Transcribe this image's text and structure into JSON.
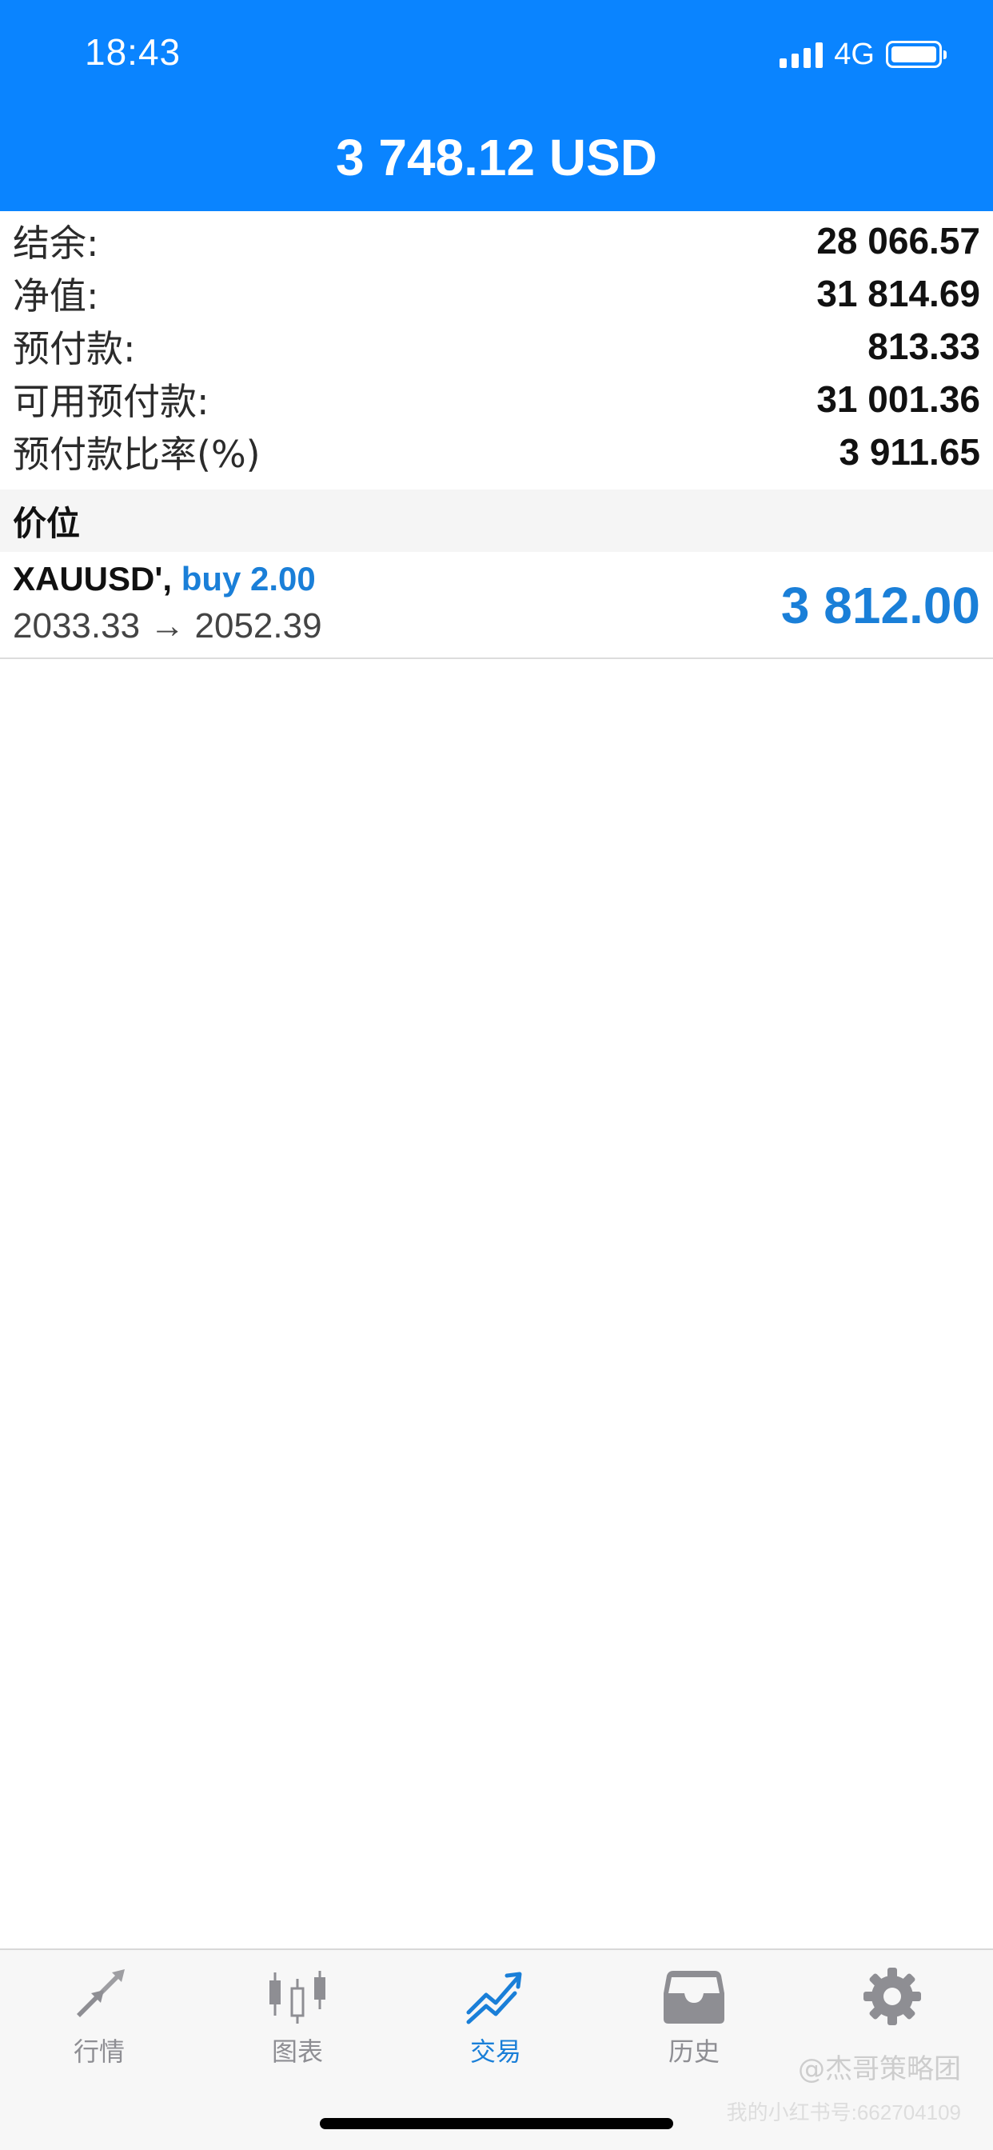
{
  "status_bar": {
    "time": "18:43",
    "network": "4G"
  },
  "header": {
    "title": "3 748.12 USD"
  },
  "summary": [
    {
      "label": "结余:",
      "value": "28 066.57"
    },
    {
      "label": "净值:",
      "value": "31 814.69"
    },
    {
      "label": "预付款:",
      "value": "813.33"
    },
    {
      "label": "可用预付款:",
      "value": "31 001.36"
    },
    {
      "label": "预付款比率(%)",
      "value": "3 911.65"
    }
  ],
  "positions_section": {
    "title": "价位"
  },
  "position": {
    "symbol": "XAUUSD',",
    "side": "buy 2.00",
    "prices": "2033.33 → 2052.39",
    "profit": "3 812.00"
  },
  "tabs": [
    {
      "label": "行情",
      "icon": "quotes-arrows-icon"
    },
    {
      "label": "图表",
      "icon": "candlestick-chart-icon"
    },
    {
      "label": "交易",
      "icon": "trade-chart-icon",
      "active": true
    },
    {
      "label": "历史",
      "icon": "history-inbox-icon"
    },
    {
      "label": "",
      "icon": "settings-gear-icon"
    }
  ],
  "watermark": {
    "brand": "@杰哥策略团",
    "id": "我的小红书号:662704109"
  },
  "colors": {
    "accent": "#0a84ff",
    "profit": "#1a7fd8",
    "tab_inactive": "#8e8e93"
  }
}
